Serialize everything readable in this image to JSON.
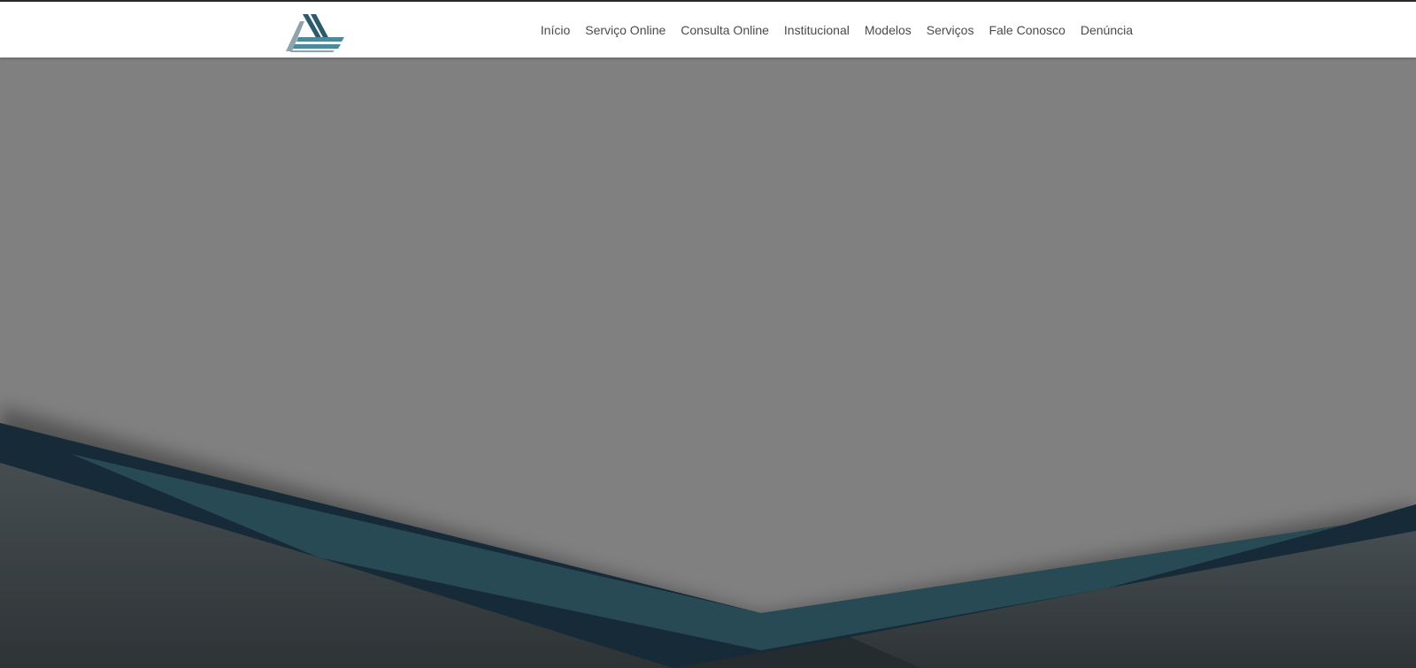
{
  "brand": {
    "logo_icon": "triangle-stripes-logo",
    "colors": {
      "logo_gray": "#8fa3ad",
      "logo_teal": "#4a8a9c",
      "logo_dark": "#2c5a6a"
    }
  },
  "nav": {
    "items": [
      {
        "label": "Início"
      },
      {
        "label": "Serviço Online"
      },
      {
        "label": "Consulta Online"
      },
      {
        "label": "Institucional"
      },
      {
        "label": "Modelos"
      },
      {
        "label": "Serviços"
      },
      {
        "label": "Fale Conosco"
      },
      {
        "label": "Denúncia"
      }
    ]
  },
  "hero": {
    "colors": {
      "background": "#808080",
      "dark_navy": "#172a38",
      "teal": "#274a55",
      "charcoal": "#3c4447"
    }
  }
}
